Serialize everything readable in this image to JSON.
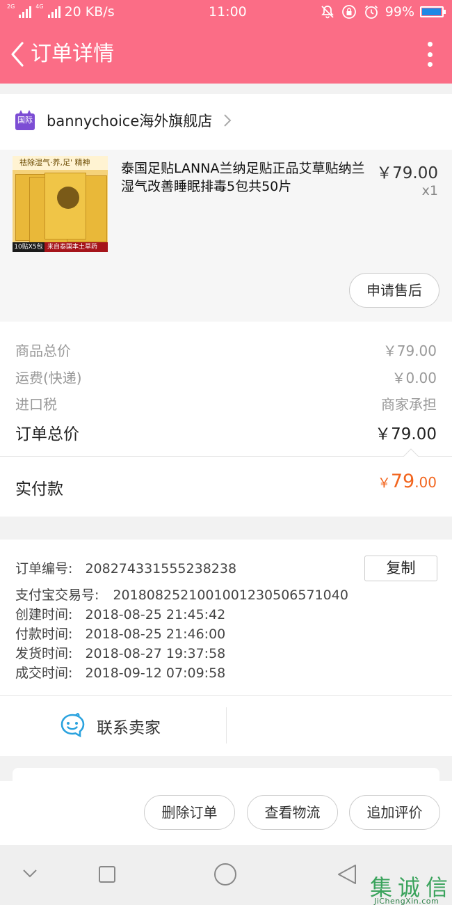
{
  "status_bar": {
    "net_speed": "20 KB/s",
    "sig_label_1": "2G",
    "sig_label_2": "4G",
    "time": "11:00",
    "battery": "99%",
    "battery_color": "#1e88e5"
  },
  "header": {
    "title": "订单详情",
    "background": "#fb6d86"
  },
  "shop": {
    "badge": "国际",
    "name": "bannychoice海外旗舰店"
  },
  "product": {
    "title": "泰国足贴LANNA兰纳足贴正品艾草贴纳兰湿气改善睡眠排毒5包共50片",
    "price": "￥79.00",
    "quantity": "x1",
    "thumb_banner": "祛除湿气·养,足' 精神",
    "thumb_pack_label": "10贴X5包",
    "thumb_origin": "来自泰国本土草药",
    "after_sales_button": "申请售后"
  },
  "totals": {
    "goods_label": "商品总价",
    "goods_value": "￥79.00",
    "shipping_label": "运费(快递)",
    "shipping_value": "￥0.00",
    "tax_label": "进口税",
    "tax_value": "商家承担",
    "order_total_label": "订单总价",
    "order_total_value": "￥79.00",
    "paid_label": "实付款",
    "paid_symbol": "￥",
    "paid_int": "79",
    "paid_dec": ".00",
    "accent": "#f2651e"
  },
  "order_info": {
    "order_no_label": "订单编号:",
    "order_no": "208274331555238238",
    "copy_button": "复制",
    "alipay_label": "支付宝交易号:",
    "alipay_no": "2018082521001001230506571040",
    "created_label": "创建时间:",
    "created": "2018-08-25 21:45:42",
    "paid_label": "付款时间:",
    "paid": "2018-08-25 21:46:00",
    "shipped_label": "发货时间:",
    "shipped": "2018-08-27 19:37:58",
    "closed_label": "成交时间:",
    "closed": "2018-09-12 07:09:58"
  },
  "contact": {
    "label": "联系卖家",
    "icon": "chat-smile-icon"
  },
  "actions": {
    "delete": "删除订单",
    "logistics": "查看物流",
    "review": "追加评价"
  },
  "watermark": {
    "chars": [
      "集",
      "诚",
      "信"
    ],
    "sub": "JiChengXin.com"
  }
}
